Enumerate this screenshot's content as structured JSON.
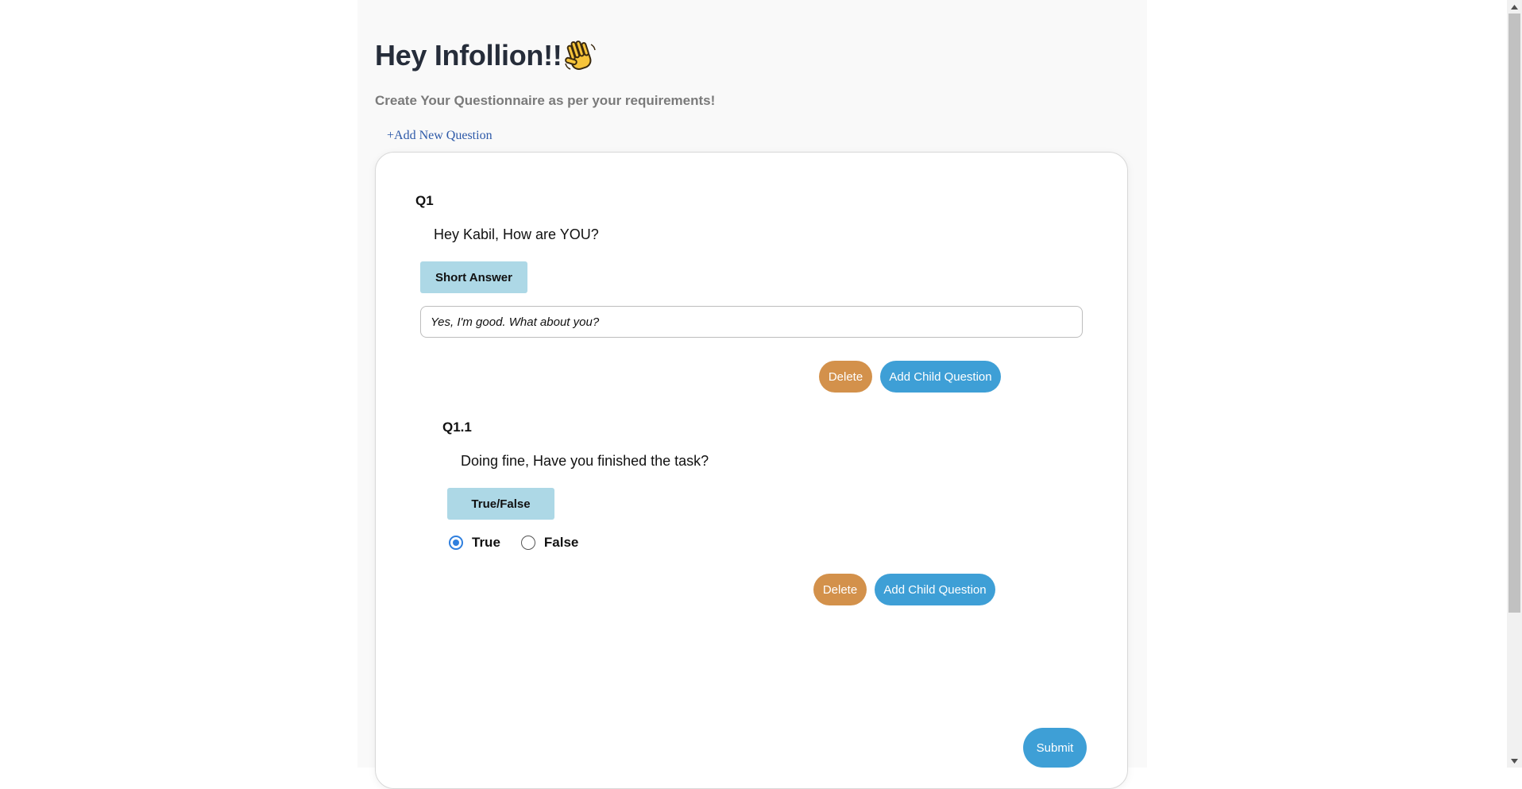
{
  "header": {
    "greeting": "Hey Infollion!!",
    "subtitle": "Create Your Questionnaire as per your requirements!",
    "add_new_question": "+Add New Question"
  },
  "questions": [
    {
      "label": "Q1",
      "text": "Hey Kabil, How are YOU?",
      "type": "Short Answer",
      "answer": "Yes, I'm good. What about you?",
      "delete_label": "Delete",
      "add_child_label": "Add Child Question"
    },
    {
      "label": "Q1.1",
      "text": "Doing fine, Have you finished the task?",
      "type": "True/False",
      "options": [
        "True",
        "False"
      ],
      "selected": "True",
      "delete_label": "Delete",
      "add_child_label": "Add Child Question"
    }
  ],
  "submit_label": "Submit",
  "icons": {
    "greeting_emoji": "waving-hand-icon"
  },
  "colors": {
    "delete": "#d3914b",
    "primary": "#3e9fd6",
    "type_badge": "#add8e6",
    "link": "#2d59a8",
    "radio_selected": "#2f7fde"
  }
}
